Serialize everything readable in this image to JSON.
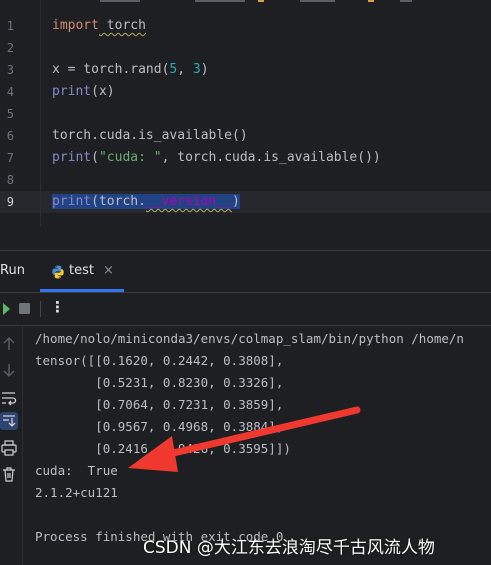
{
  "editor": {
    "line_numbers": [
      "1",
      "2",
      "3",
      "4",
      "5",
      "6",
      "7",
      "8",
      "9"
    ],
    "current_line": "9",
    "code": {
      "l1_kw": "import",
      "l1_rest": " torch",
      "l3_a": "x = torch.rand(",
      "l3_n1": "5",
      "l3_b": ", ",
      "l3_n2": "3",
      "l3_c": ")",
      "l4_fn": "print",
      "l4_rest": "(x)",
      "l6": "torch.cuda.is_available()",
      "l7_fn": "print",
      "l7_a": "(",
      "l7_str": "\"cuda: \"",
      "l7_rest": ", torch.cuda.is_available())",
      "l9_fn": "print",
      "l9_a": "(torch.",
      "l9_dunder": "__version__",
      "l9_c": ")"
    }
  },
  "toolwindow": {
    "run_label": "Run",
    "tab_label": "test",
    "tab_close": "×",
    "kebab": "⋮",
    "accent": "#3574f0"
  },
  "console": {
    "lines": [
      "/home/nolo/miniconda3/envs/colmap_slam/bin/python /home/n",
      "tensor([[0.1620, 0.2442, 0.3808],",
      "        [0.5231, 0.8230, 0.3326],",
      "        [0.7064, 0.7231, 0.3859],",
      "        [0.9567, 0.4968, 0.3884],",
      "        [0.2416, 0.9426, 0.3595]])",
      "cuda:  True",
      "2.1.2+cu121",
      "",
      "Process finished with exit code 0"
    ]
  },
  "annotation": {
    "arrow_color": "#f0392e"
  },
  "watermark": "CSDN @大江东去浪淘尽千古风流人物"
}
